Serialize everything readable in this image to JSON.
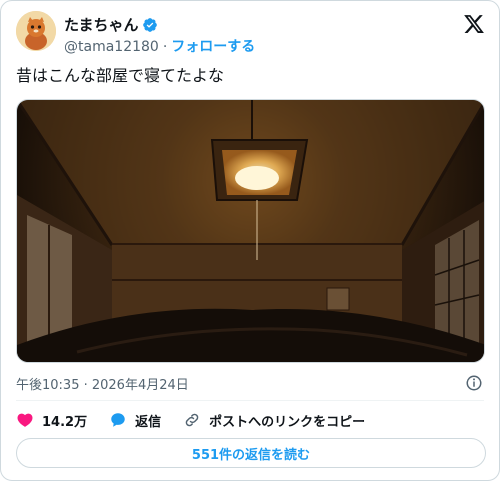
{
  "user": {
    "display_name": "たまちゃん",
    "handle": "@tama12180",
    "separator": "·",
    "follow_label": "フォローする"
  },
  "tweet": {
    "text": "昔はこんな部屋で寝てたよな",
    "timestamp": "午後10:35 · 2026年4月24日"
  },
  "actions": {
    "likes_count": "14.2万",
    "reply_label": "返信",
    "copy_link_label": "ポストへのリンクをコピー"
  },
  "read_replies_label": "551件の返信を読む",
  "colors": {
    "accent": "#1d9bf0",
    "like": "#f91880",
    "text": "#0f1419",
    "secondary": "#536471"
  },
  "icons": [
    "verified-badge-icon",
    "x-logo-icon",
    "info-icon",
    "heart-icon",
    "reply-bubble-icon",
    "link-icon"
  ]
}
